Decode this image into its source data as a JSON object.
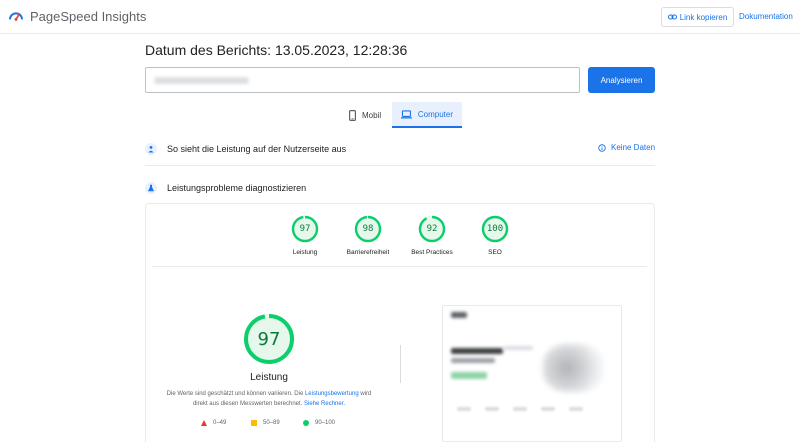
{
  "header": {
    "app_name": "PageSpeed Insights",
    "copy_link_label": "Link kopieren",
    "docs_label": "Dokumentation"
  },
  "report": {
    "title": "Datum des Berichts: 13.05.2023, 12:28:36",
    "url_value": "",
    "analyze_label": "Analysieren"
  },
  "tabs": [
    {
      "label": "Mobil",
      "active": false
    },
    {
      "label": "Computer",
      "active": true
    }
  ],
  "field_data": {
    "heading": "So sieht die Leistung auf der Nutzerseite aus",
    "status": "Keine Daten"
  },
  "lab_data": {
    "heading": "Leistungsprobleme diagnostizieren"
  },
  "categories": [
    {
      "name": "Leistung",
      "score": 97
    },
    {
      "name": "Barrierefreiheit",
      "score": 98
    },
    {
      "name": "Best Practices",
      "score": 92
    },
    {
      "name": "SEO",
      "score": 100
    }
  ],
  "performance": {
    "score": 97,
    "label": "Leistung",
    "note_part1": "Die Werte sind geschätzt und können variieren. Die ",
    "note_link1": "Leistungsbewertung",
    "note_part2": " wird direkt aus diesen Messwerten berechnet. ",
    "note_link2": "Siehe Rechner."
  },
  "legend": [
    {
      "range": "0–49",
      "color": "#e53935"
    },
    {
      "range": "50–89",
      "color": "#fbbc04"
    },
    {
      "range": "90–100",
      "color": "#0cce6b"
    }
  ],
  "colors": {
    "accent": "#1a73e8",
    "pass_green": "#0cce6b",
    "pass_text": "#0a7a3a",
    "pass_fill": "#e6f7ec"
  }
}
